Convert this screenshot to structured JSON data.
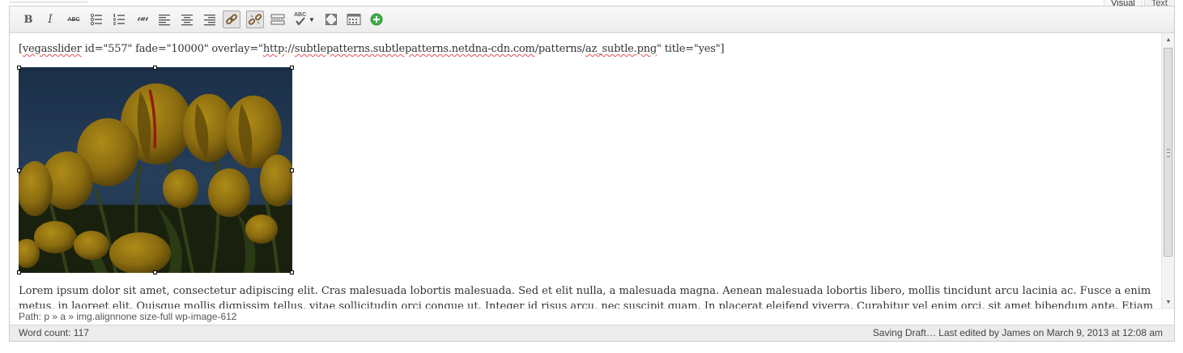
{
  "tabs": {
    "visual": "Visual",
    "text": "Text"
  },
  "toolbar": {
    "bold_label": "B",
    "italic_label": "I",
    "strike_label": "ABC",
    "quote_label": "““",
    "spell_label": "ABC",
    "buttons": [
      "bold",
      "italic",
      "strikethrough",
      "unordered-list",
      "ordered-list",
      "blockquote",
      "align-left",
      "align-center",
      "align-right",
      "insert-link",
      "remove-link",
      "more-tag",
      "spellcheck",
      "fullscreen",
      "toolbar-toggle",
      "add-media"
    ]
  },
  "content": {
    "shortcode": {
      "p1": "[",
      "w1": "vegasslider",
      "p2": " id=\"557\" fade=\"10000\" overlay=\"",
      "w2": "http",
      "p3": "://",
      "w3": "subtlepatterns.subtlepatterns.netdna-cdn.com",
      "p4": "/patterns/",
      "w4": "az_subtle.png",
      "p5": "\" title=\"yes\"]"
    },
    "paragraph": "Lorem ipsum dolor sit amet, consectetur adipiscing elit. Cras malesuada lobortis malesuada. Sed et elit nulla, a malesuada magna. Aenean malesuada lobortis libero, mollis tincidunt arcu lacinia ac. Fusce a enim metus, in laoreet elit. Quisque mollis dignissim tellus, vitae sollicitudin orci congue ut. Integer id risus arcu, nec suscipit quam. In placerat eleifend viverra. Curabitur vel enim orci, sit amet bibendum ante. Etiam feugiat lectus vel odio mollis."
  },
  "path": "Path: p » a » img.alignnone size-full wp-image-612",
  "status": {
    "word_count": "Word count: 117",
    "draft": "Saving Draft… Last edited by James on March 9, 2013 at 12:08 am"
  },
  "colors": {
    "toolbar_bg": "#ececec",
    "add_media": "#3fae49",
    "spell_underline": "#e05050"
  }
}
